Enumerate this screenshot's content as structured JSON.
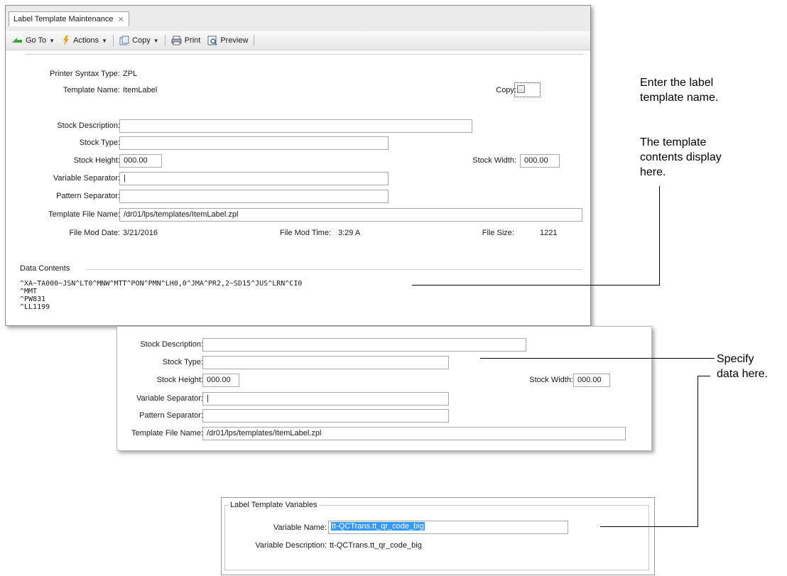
{
  "window": {
    "tab_label": "Label Template Maintenance",
    "tab_close": "✕"
  },
  "toolbar": {
    "goto_label": "Go To",
    "actions_label": "Actions",
    "copy_label": "Copy",
    "print_label": "Print",
    "preview_label": "Preview"
  },
  "form1": {
    "printer_syntax_label": "Printer Syntax Type:",
    "printer_syntax_value": "ZPL",
    "template_name_label": "Template Name:",
    "template_name_value": "ItemLabel",
    "copy_label": "Copy:",
    "stock_description_label": "Stock Description:",
    "stock_description_value": "",
    "stock_type_label": "Stock Type:",
    "stock_type_value": "",
    "stock_height_label": "Stock Height:",
    "stock_height_value": "000.00",
    "stock_width_label": "Stock Width:",
    "stock_width_value": "000.00",
    "variable_separator_label": "Variable Separator:",
    "variable_separator_value": "|",
    "pattern_separator_label": "Pattern Separator:",
    "pattern_separator_value": "",
    "template_file_label": "Template File Name:",
    "template_file_value": "/dr01/lps/templates/ItemLabel.zpl",
    "file_mod_date_label": "File Mod Date:",
    "file_mod_date_value": "3/21/2016",
    "file_mod_time_label": "File Mod Time:",
    "file_mod_time_value": "3:29 A",
    "file_size_label": "File Size:",
    "file_size_value": "1221",
    "data_contents_label": "Data Contents",
    "data_lines": [
      "^XA~TA000~JSN^LT0^MNW^MTT^PON^PMN^LH0,0^JMA^PR2,2~SD15^JUS^LRN^CI0",
      "^MMT",
      "^PW831",
      "^LL1199"
    ]
  },
  "form2": {
    "stock_description_label": "Stock Description:",
    "stock_description_value": "",
    "stock_type_label": "Stock Type:",
    "stock_type_value": "",
    "stock_height_label": "Stock Height:",
    "stock_height_value": "000.00",
    "stock_width_label": "Stock Width:",
    "stock_width_value": "000.00",
    "variable_separator_label": "Variable Separator:",
    "variable_separator_value": "|",
    "pattern_separator_label": "Pattern Separator:",
    "pattern_separator_value": "",
    "template_file_label": "Template File Name:",
    "template_file_value": "/dr01/lps/templates/ItemLabel.zpl"
  },
  "form3": {
    "group_label": "Label Template Variables",
    "variable_name_label": "Variable Name:",
    "variable_name_value": "tt-QCTrans.tt_qr_code_big",
    "variable_description_label": "Variable Description:",
    "variable_description_value": "tt-QCTrans.tt_qr_code_big"
  },
  "callouts": {
    "label_name_line1": "Enter the label",
    "label_name_line2": "template name.",
    "contents_line1": "The template",
    "contents_line2": "contents display",
    "contents_line3": "here.",
    "specify_line1": "Specify",
    "specify_line2": "data here."
  },
  "colors": {
    "selection": "#3399ff",
    "tab_strip": "#ececec",
    "callout_line": "#000000"
  }
}
